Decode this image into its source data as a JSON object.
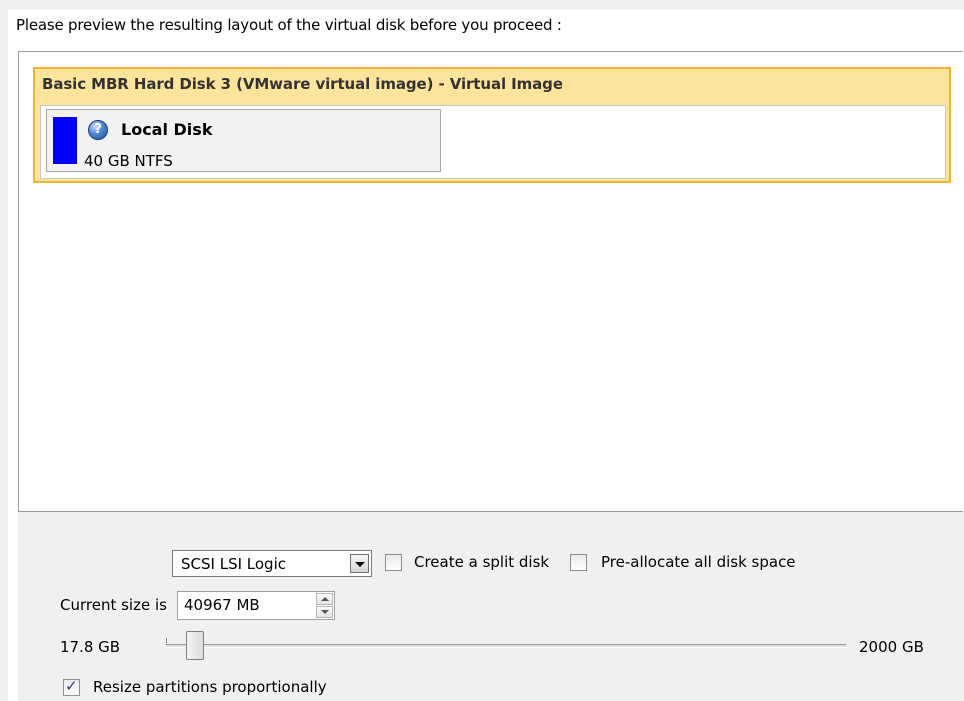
{
  "header": {
    "instruction": "Please preview the resulting layout of the virtual disk before you proceed :"
  },
  "disk": {
    "title": "Basic MBR Hard Disk 3 (VMware virtual image) - Virtual Image",
    "partitions": [
      {
        "name": "Local Disk",
        "info": "40 GB NTFS",
        "icon": "help-icon",
        "color": "#0000ff"
      }
    ],
    "accent_color": "#f5b332",
    "background_color": "#fde49b"
  },
  "options": {
    "controller_select": {
      "value": "SCSI LSI Logic"
    },
    "split_disk": {
      "label": "Create a split disk",
      "checked": false
    },
    "preallocate": {
      "label": "Pre-allocate all disk space",
      "checked": false
    },
    "size": {
      "label": "Current size is",
      "value": "40967 MB"
    },
    "slider": {
      "min_label": "17.8 GB",
      "max_label": "2000 GB",
      "position_fraction": 0.01
    },
    "resize_proportionally": {
      "label": "Resize partitions proportionally",
      "checked": true
    }
  }
}
